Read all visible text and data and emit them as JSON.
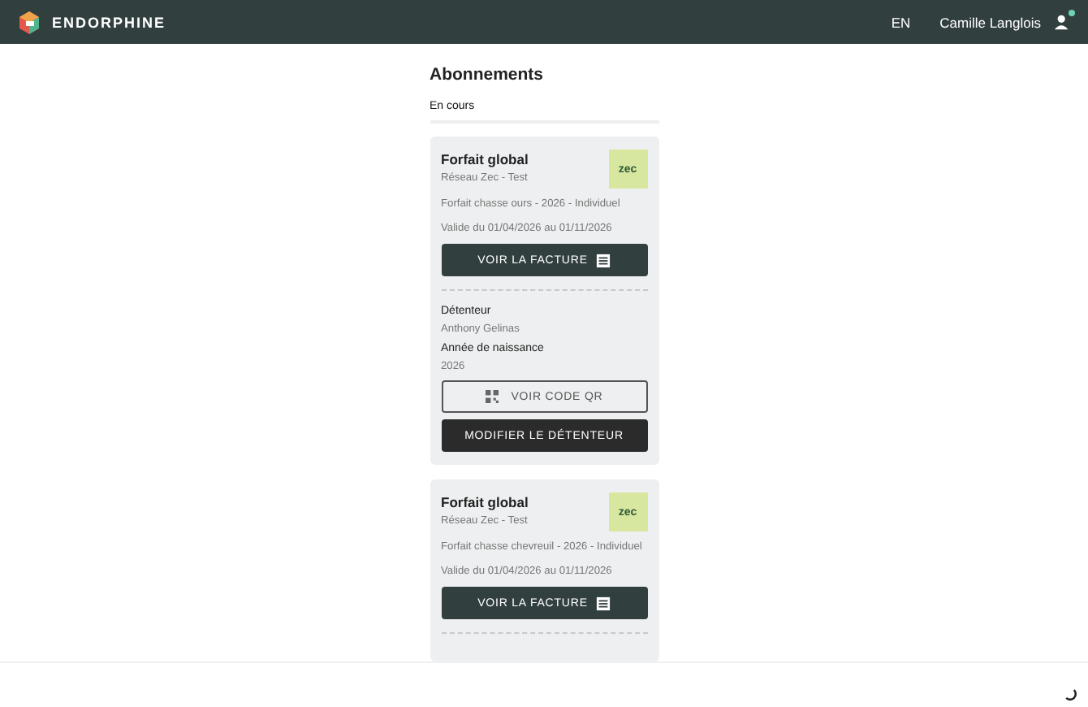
{
  "header": {
    "brand": "ENDORPHINE",
    "language": "EN",
    "user_name": "Camille Langlois",
    "user_notification": true
  },
  "page_title": "Abonnements",
  "tabs": [
    {
      "label": "En cours",
      "selected": true
    }
  ],
  "subscriptions": [
    {
      "title": "Forfait global",
      "network": "Réseau Zec - Test",
      "logo_text": "zec",
      "description": "Forfait chasse ours - 2026 - Individuel",
      "validity": "Valide du 01/04/2026 au 01/11/2026",
      "invoice_button": "VOIR LA FACTURE",
      "holder": {
        "label": "Détenteur",
        "name": "Anthony Gelinas",
        "birth_label": "Année de naissance",
        "birth_year": "2026",
        "qr_button": "VOIR CODE QR",
        "edit_button": "MODIFIER LE DÉTENTEUR"
      }
    },
    {
      "title": "Forfait global",
      "network": "Réseau Zec - Test",
      "logo_text": "zec",
      "description": "Forfait chasse chevreuil - 2026 - Individuel",
      "validity": "Valide du 01/04/2026 au 01/11/2026",
      "invoice_button": "VOIR LA FACTURE"
    }
  ],
  "loading": true
}
